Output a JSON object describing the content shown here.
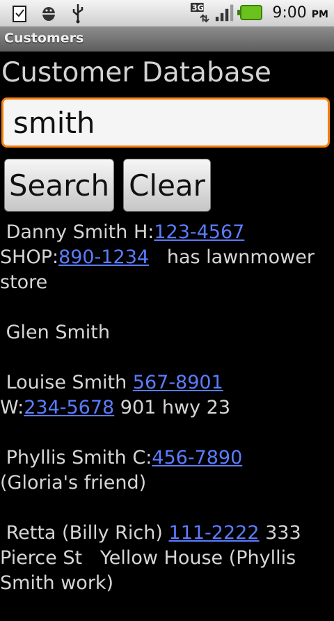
{
  "status_bar": {
    "time": "9:00",
    "ampm": "PM",
    "network": "3G",
    "icons": [
      "clipboard-icon",
      "android-debug-icon",
      "usb-icon",
      "network-3g-icon",
      "signal-icon",
      "battery-icon"
    ]
  },
  "title_bar": {
    "title": "Customers"
  },
  "main": {
    "heading": "Customer Database",
    "search": {
      "value": "smith"
    },
    "buttons": {
      "search": "Search",
      "clear": "Clear"
    }
  },
  "results": [
    {
      "parts": [
        {
          "t": " Danny Smith H:"
        },
        {
          "link": "123-4567"
        },
        {
          "t": "\nSHOP:"
        },
        {
          "link": "890-1234"
        },
        {
          "t": "   has lawnmower store"
        }
      ]
    },
    {
      "parts": [
        {
          "t": " Glen Smith"
        }
      ]
    },
    {
      "parts": [
        {
          "t": " Louise Smith "
        },
        {
          "link": "567-8901"
        },
        {
          "t": "\nW:"
        },
        {
          "link": "234-5678"
        },
        {
          "t": " 901 hwy 23"
        }
      ]
    },
    {
      "parts": [
        {
          "t": " Phyllis Smith C:"
        },
        {
          "link": "456-7890"
        },
        {
          "t": "\n(Gloria's friend)"
        }
      ]
    },
    {
      "parts": [
        {
          "t": " Retta (Billy Rich) "
        },
        {
          "link": "111-2222"
        },
        {
          "t": " 333\nPierce St   Yellow House (Phyllis\nSmith work)"
        }
      ]
    }
  ],
  "colors": {
    "accent": "#f57f0c",
    "link": "#5b7cff"
  }
}
